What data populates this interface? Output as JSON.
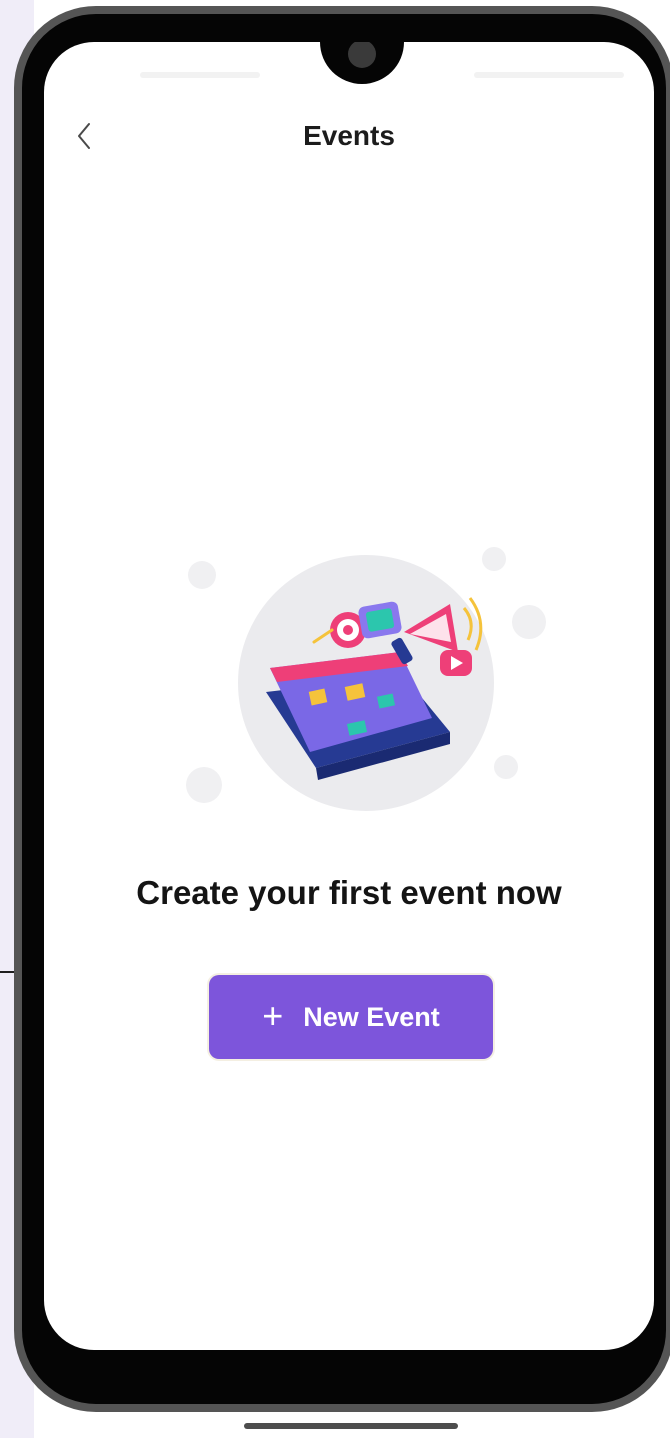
{
  "header": {
    "title": "Events",
    "back_icon": "chevron-left-icon"
  },
  "empty_state": {
    "illustration_icon": "event-celebration-illustration",
    "heading": "Create your first event now"
  },
  "actions": {
    "new_event_icon": "plus-icon",
    "new_event_label": "New Event"
  },
  "colors": {
    "accent": "#7d55db",
    "title_text": "#1c1c1c",
    "illustration_circle": "#ebebee"
  }
}
